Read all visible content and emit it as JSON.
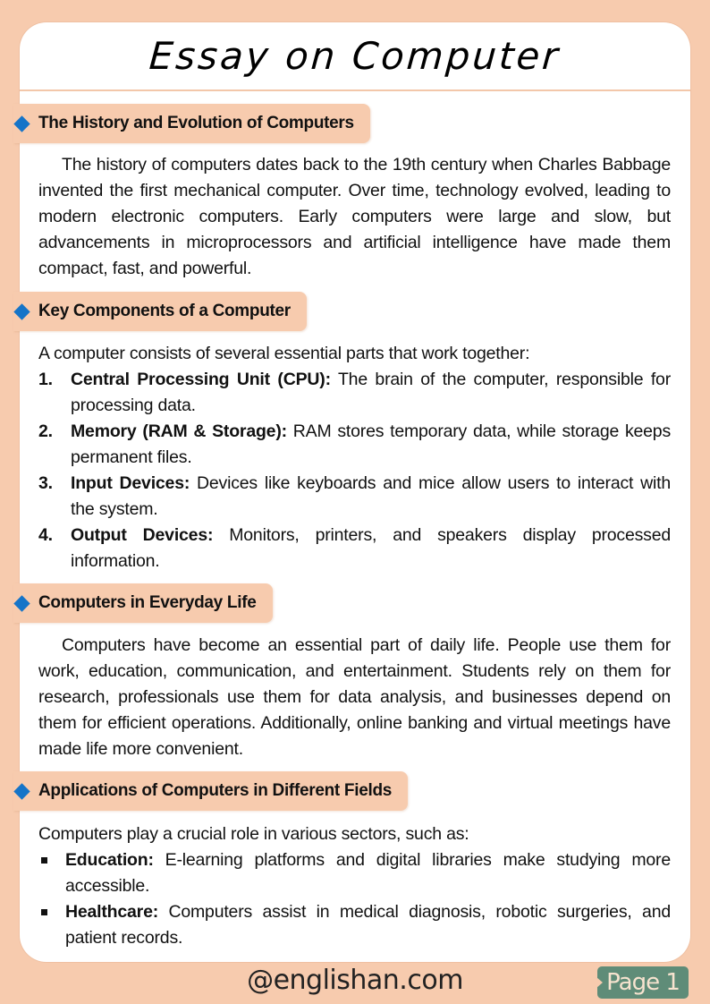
{
  "title": "Essay on Computer",
  "sections": [
    {
      "heading": "The History and Evolution of Computers",
      "paragraph": "The history of computers dates back to the 19th century when Charles Babbage invented the first mechanical computer. Over time, technology evolved, leading to modern electronic computers. Early computers were large and slow, but advancements in microprocessors and artificial intelligence have made them compact, fast, and powerful."
    },
    {
      "heading": "Key Components of a Computer",
      "intro": "A computer consists of several essential parts that work together:",
      "items": [
        {
          "marker": "1.",
          "term": "Central Processing Unit (CPU):",
          "text": " The brain of the computer, responsible for processing data."
        },
        {
          "marker": "2.",
          "term": "Memory (RAM & Storage):",
          "text": " RAM stores temporary data, while storage keeps permanent files."
        },
        {
          "marker": "3.",
          "term": "Input Devices:",
          "text": " Devices like keyboards and mice allow users to interact with the system."
        },
        {
          "marker": "4.",
          "term": "Output Devices:",
          "text": " Monitors, printers, and speakers display processed information."
        }
      ]
    },
    {
      "heading": "Computers in Everyday Life",
      "paragraph": "Computers have become an essential part of daily life. People use them for work, education, communication, and entertainment. Students rely on them for research, professionals use them for data analysis, and businesses depend on them for efficient operations. Additionally, online banking and virtual meetings have made life more convenient."
    },
    {
      "heading": "Applications of Computers in Different Fields",
      "intro": "Computers play a crucial role in various sectors, such as:",
      "items": [
        {
          "term": "Education:",
          "text": " E-learning platforms and digital libraries make studying more accessible."
        },
        {
          "term": "Healthcare:",
          "text": " Computers assist in medical diagnosis, robotic surgeries, and patient records."
        }
      ]
    }
  ],
  "footer": {
    "website": "@englishan.com",
    "page_label": "Page 1"
  },
  "colors": {
    "background": "#f7cbae",
    "card": "#ffffff",
    "diamond": "#1574c8",
    "page_badge": "#5f8c78"
  }
}
